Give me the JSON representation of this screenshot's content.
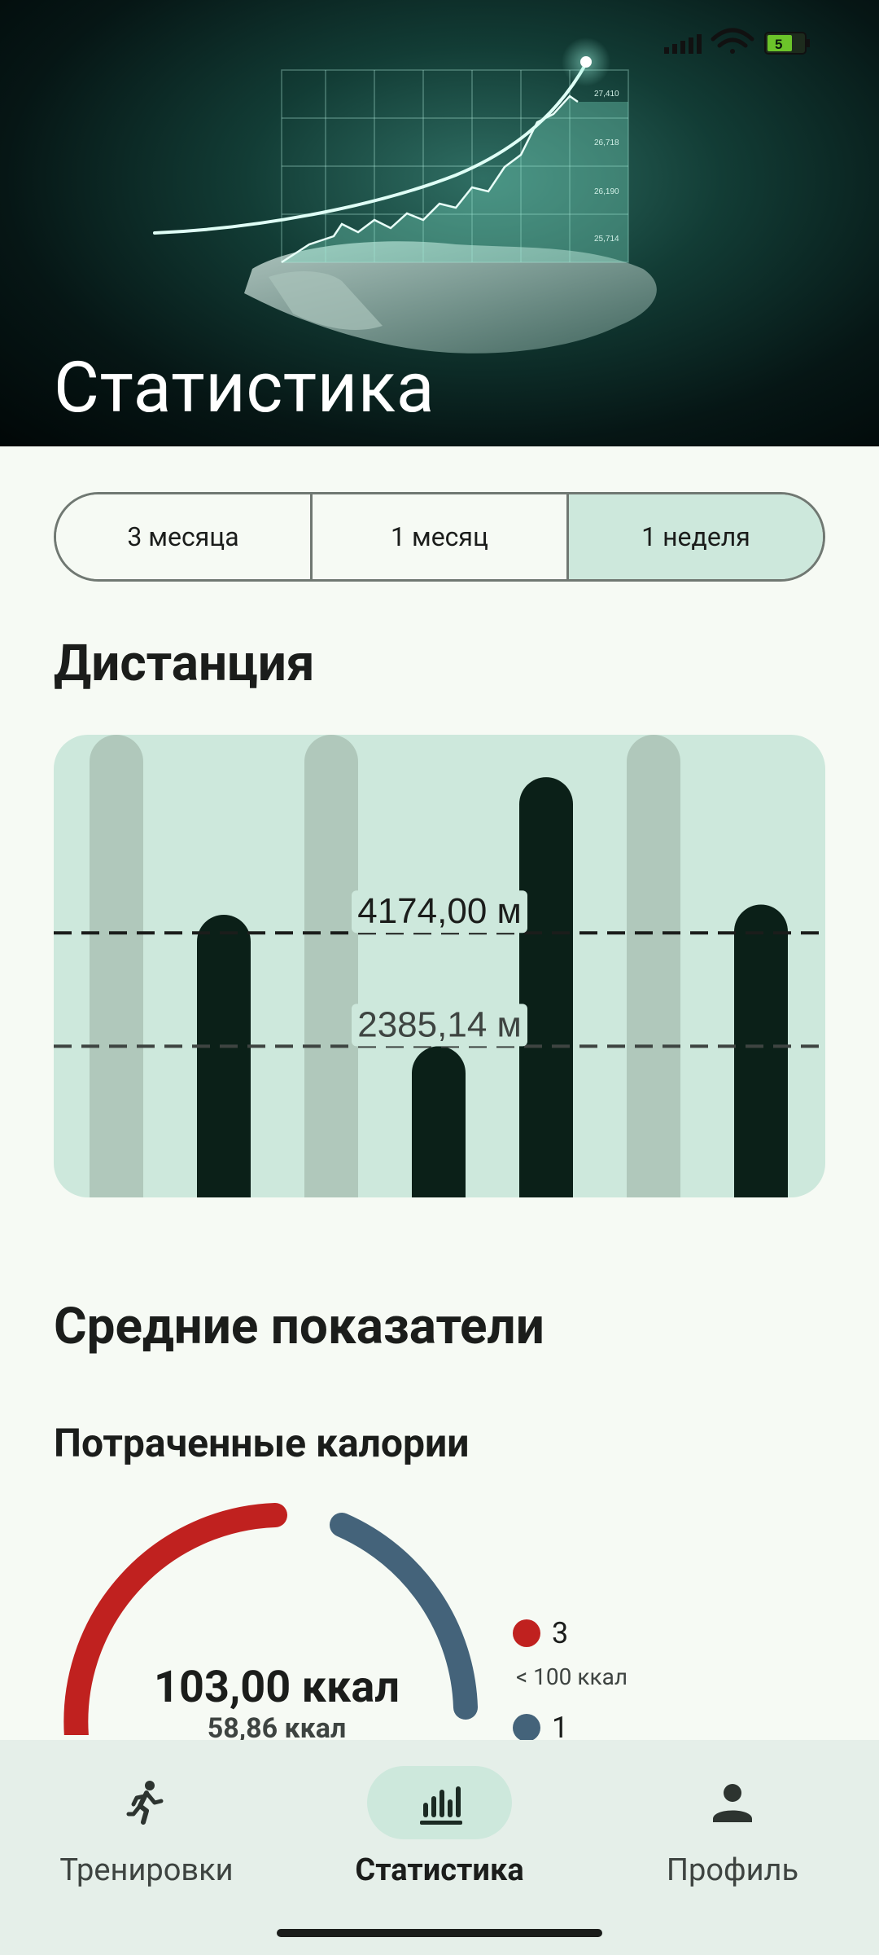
{
  "header": {
    "title": "Статистика",
    "hero_image": "hand-holding-growth-chart-illustration",
    "chart_label_values": [
      "27,410",
      "26,718",
      "26,190",
      "25,714"
    ]
  },
  "status_bar": {
    "signal_icon": "signal-bars-icon",
    "wifi_icon": "wifi-icon",
    "battery_icon": "battery-icon",
    "battery_level": "5"
  },
  "period_selector": {
    "options": [
      {
        "label": "3 месяца",
        "selected": false
      },
      {
        "label": "1 месяц",
        "selected": false
      },
      {
        "label": "1 неделя",
        "selected": true
      }
    ]
  },
  "distance": {
    "title": "Дистанция",
    "chart_data": {
      "type": "bar",
      "values": [
        0,
        4460,
        0,
        2385.14,
        6630,
        0,
        4620
      ],
      "reference_lines": [
        {
          "label": "4174,00 м",
          "value": 4174.0
        },
        {
          "label": "2385,14 м",
          "value": 2385.14
        }
      ],
      "ylim": [
        0,
        7300
      ],
      "colors": {
        "bar": "#0b2018",
        "empty_bar": "#b0c8bb",
        "background": "#cde8dc"
      }
    }
  },
  "averages": {
    "title": "Средние показатели",
    "calories": {
      "title": "Потраченные калории",
      "main_value": "103,00 ккал",
      "sub_value": "58,86 ккал",
      "segments": [
        {
          "count": "3",
          "desc": "< 100 ккал",
          "color": "#c0211f",
          "share": 0.5
        },
        {
          "count": "1",
          "desc": "",
          "color": "#44637a",
          "share": 0.25
        }
      ]
    }
  },
  "nav": {
    "items": [
      {
        "label": "Тренировки",
        "icon": "running-person-icon",
        "active": false
      },
      {
        "label": "Статистика",
        "icon": "bar-chart-icon",
        "active": true
      },
      {
        "label": "Профиль",
        "icon": "person-icon",
        "active": false
      }
    ]
  }
}
